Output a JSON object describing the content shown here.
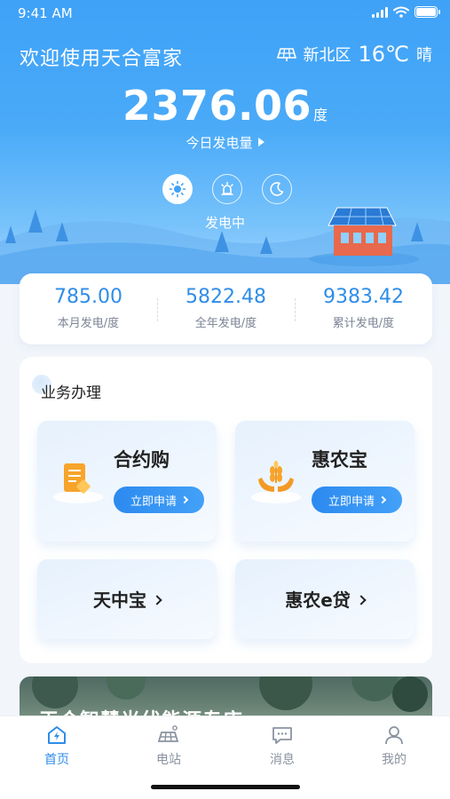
{
  "status_bar": {
    "time": "9:41 AM"
  },
  "header": {
    "welcome": "欢迎使用天合富家",
    "weather": {
      "location": "新北区",
      "temperature": "16℃",
      "condition": "晴"
    },
    "generation": {
      "value": "2376.06",
      "unit": "度",
      "label": "今日发电量"
    },
    "modes": [
      "sun-icon",
      "alarm-icon",
      "moon-icon"
    ],
    "state": "发电中"
  },
  "stats": [
    {
      "value": "785.00",
      "label": "本月发电/度"
    },
    {
      "value": "5822.48",
      "label": "全年发电/度"
    },
    {
      "value": "9383.42",
      "label": "累计发电/度"
    }
  ],
  "business": {
    "title": "业务办理",
    "tiles": [
      {
        "title": "合约购",
        "button": "立即申请"
      },
      {
        "title": "惠农宝",
        "button": "立即申请"
      }
    ],
    "links": [
      {
        "title": "天中宝"
      },
      {
        "title": "惠农e贷"
      }
    ]
  },
  "banner": {
    "text": "天合智慧光伏能源专店"
  },
  "tabs": [
    {
      "label": "首页",
      "icon": "home-icon",
      "active": true
    },
    {
      "label": "电站",
      "icon": "power-station-icon",
      "active": false
    },
    {
      "label": "消息",
      "icon": "message-icon",
      "active": false
    },
    {
      "label": "我的",
      "icon": "profile-icon",
      "active": false
    }
  ],
  "colors": {
    "primary": "#2f8de8",
    "header_top": "#3fa2f7",
    "text_dark": "#222222",
    "text_muted": "#7b8494"
  }
}
